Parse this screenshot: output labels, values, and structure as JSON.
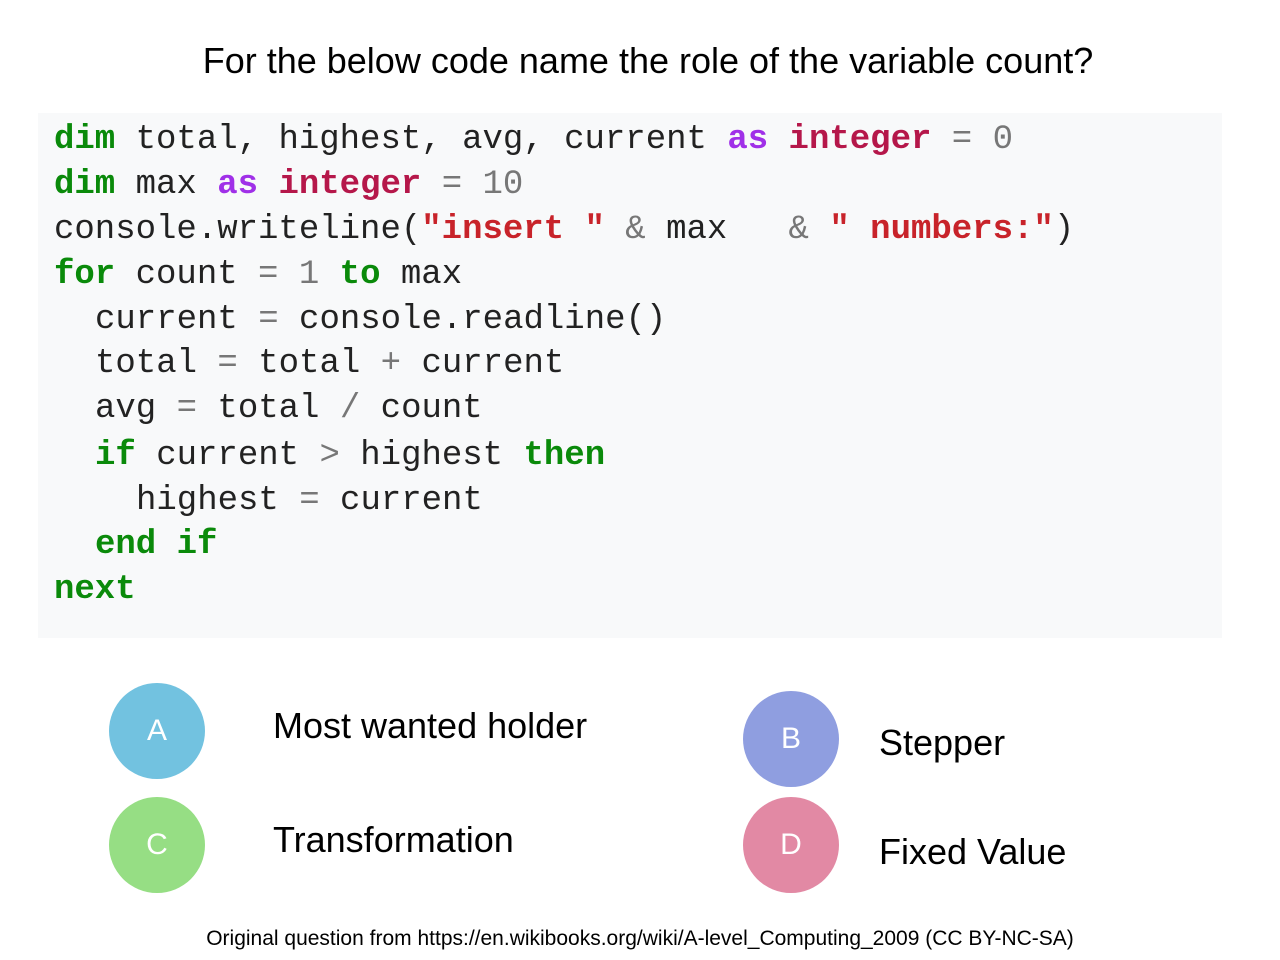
{
  "question": "For the below code name the role of the variable count?",
  "code": [
    {
      "indent": 0,
      "tokens": [
        [
          "dim",
          "kw"
        ],
        [
          " total, highest, avg, current ",
          "id"
        ],
        [
          "as",
          "as"
        ],
        [
          " ",
          "id"
        ],
        [
          "integer",
          "ty"
        ],
        [
          " = ",
          "op"
        ],
        [
          "0",
          "num"
        ]
      ]
    },
    {
      "indent": 0,
      "tokens": [
        [
          "dim",
          "kw"
        ],
        [
          " max ",
          "id"
        ],
        [
          "as",
          "as"
        ],
        [
          " ",
          "id"
        ],
        [
          "integer",
          "ty"
        ],
        [
          " = ",
          "op"
        ],
        [
          "10",
          "num"
        ]
      ]
    },
    {
      "indent": 0,
      "tokens": [
        [
          "console.writeline(",
          "id"
        ],
        [
          "\"insert \"",
          "str"
        ],
        [
          " & ",
          "op"
        ],
        [
          "max  ",
          "id"
        ],
        [
          " & ",
          "op"
        ],
        [
          "\" numbers:\"",
          "str"
        ],
        [
          ")",
          "id"
        ]
      ]
    },
    {
      "indent": 0,
      "tokens": [
        [
          "for",
          "kw"
        ],
        [
          " count ",
          "id"
        ],
        [
          "=",
          "op"
        ],
        [
          " ",
          "id"
        ],
        [
          "1",
          "num"
        ],
        [
          " ",
          "id"
        ],
        [
          "to",
          "kw"
        ],
        [
          " max",
          "id"
        ]
      ]
    },
    {
      "indent": 1,
      "tokens": [
        [
          "current ",
          "id"
        ],
        [
          "=",
          "op"
        ],
        [
          " console.readline()",
          "id"
        ]
      ]
    },
    {
      "indent": 1,
      "tokens": [
        [
          "total ",
          "id"
        ],
        [
          "=",
          "op"
        ],
        [
          " total ",
          "id"
        ],
        [
          "+",
          "op"
        ],
        [
          " current",
          "id"
        ]
      ]
    },
    {
      "indent": 1,
      "tokens": [
        [
          "avg ",
          "id"
        ],
        [
          "=",
          "op"
        ],
        [
          " total ",
          "id"
        ],
        [
          "/",
          "op"
        ],
        [
          " count",
          "id"
        ]
      ]
    },
    {
      "indent": 1,
      "tokens": [
        [
          "if",
          "kw"
        ],
        [
          " current ",
          "id"
        ],
        [
          ">",
          "op"
        ],
        [
          " highest ",
          "id"
        ],
        [
          "then",
          "kw"
        ]
      ]
    },
    {
      "indent": 2,
      "tokens": [
        [
          "highest ",
          "id"
        ],
        [
          "=",
          "op"
        ],
        [
          " current",
          "id"
        ]
      ]
    },
    {
      "indent": 1,
      "tokens": [
        [
          "end if",
          "kw"
        ]
      ]
    },
    {
      "indent": 0,
      "tokens": [
        [
          "next",
          "kw"
        ]
      ]
    }
  ],
  "options": [
    {
      "letter": "A",
      "label": "Most wanted holder",
      "color": "#72c2e0"
    },
    {
      "letter": "B",
      "label": "Stepper",
      "color": "#8f9ee0"
    },
    {
      "letter": "C",
      "label": "Transformation",
      "color": "#96de84"
    },
    {
      "letter": "D",
      "label": "Fixed Value",
      "color": "#e289a4"
    }
  ],
  "footer": "Original question from https://en.wikibooks.org/wiki/A-level_Computing_2009 (CC BY-NC-SA)"
}
